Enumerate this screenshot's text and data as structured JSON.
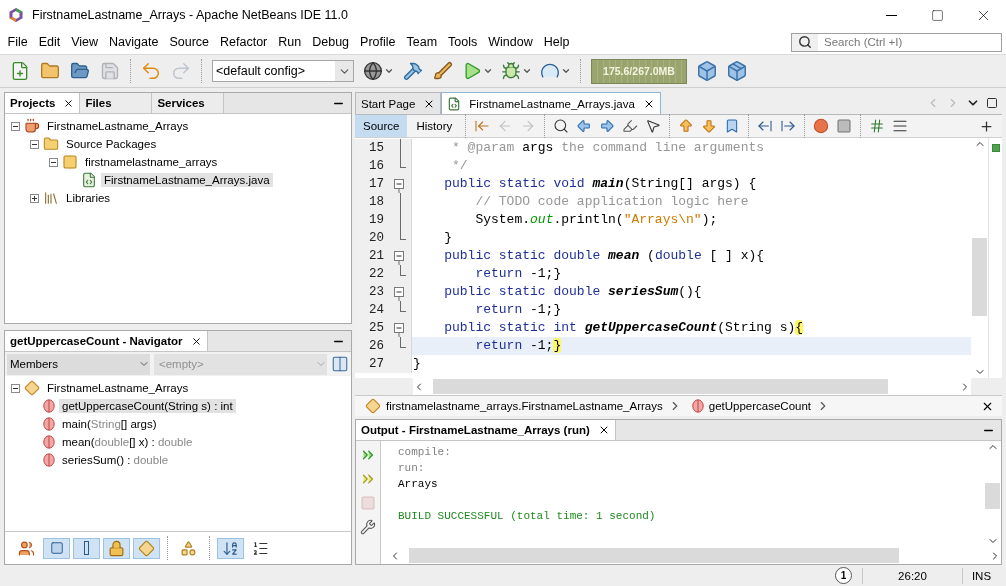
{
  "window": {
    "title": "FirstnameLastname_Arrays - Apache NetBeans IDE 11.0"
  },
  "menu": [
    "File",
    "Edit",
    "View",
    "Navigate",
    "Source",
    "Refactor",
    "Run",
    "Debug",
    "Profile",
    "Team",
    "Tools",
    "Window",
    "Help"
  ],
  "search": {
    "placeholder": "Search (Ctrl +I)"
  },
  "toolbar": {
    "groups": [
      [
        {
          "kind": "new-file",
          "disabled": false
        },
        {
          "kind": "new-project",
          "disabled": false
        },
        {
          "kind": "open-project",
          "disabled": false
        },
        {
          "kind": "save-all",
          "disabled": true
        }
      ],
      [
        {
          "kind": "undo",
          "disabled": false
        },
        {
          "kind": "redo",
          "disabled": true
        }
      ],
      [
        {
          "kind": "globe",
          "disabled": false,
          "has_menu": true
        },
        {
          "kind": "build",
          "disabled": false
        },
        {
          "kind": "clean-build",
          "disabled": false
        },
        {
          "kind": "run",
          "disabled": false,
          "has_menu": true
        },
        {
          "kind": "debug",
          "disabled": false,
          "has_menu": true
        },
        {
          "kind": "profile",
          "disabled": false,
          "has_menu": true
        }
      ],
      [
        {
          "kind": "gc",
          "disabled": false
        },
        {
          "kind": "pause",
          "disabled": false
        }
      ]
    ],
    "config": "<default config>",
    "memory": "175.6/267.0MB"
  },
  "projects_panel": {
    "tabs": [
      {
        "label": "Projects",
        "selected": true
      },
      {
        "label": "Files",
        "selected": false
      },
      {
        "label": "Services",
        "selected": false
      }
    ],
    "tree": [
      {
        "label": "FirstnameLastname_Arrays",
        "kind": "project",
        "expanded": true,
        "selected": false,
        "children": [
          {
            "label": "Source Packages",
            "kind": "source-folder",
            "expanded": true,
            "selected": false,
            "children": [
              {
                "label": "firstnamelastname_arrays",
                "kind": "package",
                "expanded": true,
                "selected": false,
                "children": [
                  {
                    "label": "FirstnameLastname_Arrays.java",
                    "kind": "java-file",
                    "selected": true
                  }
                ]
              }
            ]
          },
          {
            "label": "Libraries",
            "kind": "library-folder",
            "expanded": false,
            "selected": false
          }
        ]
      }
    ]
  },
  "navigator": {
    "title": "getUppercaseCount - Navigator",
    "filter": "Members",
    "scope": {
      "placeholder": "<empty>"
    },
    "tree": [
      {
        "label": "FirstnameLastname_Arrays",
        "kind": "class",
        "expanded": true,
        "selected": false,
        "children": [
          {
            "kind": "method",
            "selected": true,
            "parts": [
              {
                "text": "getUppercaseCount(String s) : int",
                "muted": false
              }
            ]
          },
          {
            "kind": "method",
            "selected": false,
            "parts": [
              {
                "text": "main(",
                "muted": false
              },
              {
                "text": "String",
                "muted": true
              },
              {
                "text": "[] args)",
                "muted": false
              }
            ]
          },
          {
            "kind": "method",
            "selected": false,
            "parts": [
              {
                "text": "mean(",
                "muted": false
              },
              {
                "text": "double",
                "muted": true
              },
              {
                "text": "[] x) : ",
                "muted": false
              },
              {
                "text": "double",
                "muted": true
              }
            ]
          },
          {
            "kind": "method",
            "selected": false,
            "parts": [
              {
                "text": "seriesSum() : ",
                "muted": false
              },
              {
                "text": "double",
                "muted": true
              }
            ]
          }
        ]
      }
    ],
    "filters": [
      {
        "kind": "inherited",
        "selected": false
      },
      {
        "kind": "fields",
        "selected": true
      },
      {
        "kind": "static",
        "selected": true
      },
      {
        "kind": "non-public",
        "selected": true
      },
      {
        "kind": "local-classes",
        "selected": true
      },
      {
        "kind": "class-members",
        "selected": false
      },
      {
        "kind": "sort-name",
        "selected": true
      },
      {
        "kind": "sort-source",
        "selected": false
      }
    ]
  },
  "editor": {
    "tabs": [
      {
        "label": "Start Page",
        "selected": false
      },
      {
        "label": "FirstnameLastname_Arrays.java",
        "selected": true
      }
    ],
    "views": [
      {
        "label": "Source",
        "selected": true
      },
      {
        "label": "History",
        "selected": false
      }
    ],
    "tools": [
      {
        "kind": "last-edit",
        "disabled": false
      },
      {
        "kind": "back",
        "disabled": true
      },
      {
        "kind": "forward",
        "disabled": true
      },
      {
        "kind": "find",
        "disabled": false
      },
      {
        "kind": "find-previous",
        "disabled": false
      },
      {
        "kind": "find-next",
        "disabled": false
      },
      {
        "kind": "highlight",
        "disabled": false
      },
      {
        "kind": "select",
        "disabled": false
      },
      {
        "kind": "previous-bookmark",
        "disabled": false
      },
      {
        "kind": "next-bookmark",
        "disabled": false
      },
      {
        "kind": "toggle-bookmark",
        "disabled": false
      },
      {
        "kind": "shift-left",
        "disabled": false
      },
      {
        "kind": "shift-right",
        "disabled": false
      },
      {
        "kind": "record",
        "disabled": false
      },
      {
        "kind": "stop",
        "disabled": false
      },
      {
        "kind": "comment",
        "disabled": false
      },
      {
        "kind": "uncomment",
        "disabled": false
      }
    ],
    "lines": [
      {
        "number": "15",
        "kind": "line",
        "current": false,
        "tokens": [
          {
            "text": "     * @param ",
            "kind": "comment"
          },
          {
            "text": "args",
            "kind": "plain"
          },
          {
            "text": " the command line arguments",
            "kind": "comment"
          }
        ]
      },
      {
        "number": "16",
        "kind": "end",
        "current": false,
        "tokens": [
          {
            "text": "     */",
            "kind": "comment"
          }
        ]
      },
      {
        "number": "17",
        "kind": "open",
        "current": false,
        "tokens": [
          {
            "text": "    public static void ",
            "kind": "keyword"
          },
          {
            "text": "main",
            "kind": "method"
          },
          {
            "text": "(String[] args) {",
            "kind": "plain"
          }
        ]
      },
      {
        "number": "18",
        "kind": "line",
        "current": false,
        "tokens": [
          {
            "text": "        // TODO code application logic here",
            "kind": "comment"
          }
        ]
      },
      {
        "number": "19",
        "kind": "line",
        "current": false,
        "tokens": [
          {
            "text": "        System.",
            "kind": "plain"
          },
          {
            "text": "out",
            "kind": "field"
          },
          {
            "text": ".println(",
            "kind": "plain"
          },
          {
            "text": "\"Arrays\\n\"",
            "kind": "string"
          },
          {
            "text": ");",
            "kind": "plain"
          }
        ]
      },
      {
        "number": "20",
        "kind": "end",
        "current": false,
        "tokens": [
          {
            "text": "    }",
            "kind": "plain"
          }
        ]
      },
      {
        "number": "21",
        "kind": "open",
        "current": false,
        "tokens": [
          {
            "text": "    public static double ",
            "kind": "keyword"
          },
          {
            "text": "mean",
            "kind": "method"
          },
          {
            "text": " (",
            "kind": "plain"
          },
          {
            "text": "double",
            "kind": "keyword"
          },
          {
            "text": " [ ] x){",
            "kind": "plain"
          }
        ]
      },
      {
        "number": "22",
        "kind": "end",
        "current": false,
        "tokens": [
          {
            "text": "        return",
            "kind": "keyword"
          },
          {
            "text": " -1;}",
            "kind": "plain"
          }
        ]
      },
      {
        "number": "23",
        "kind": "open",
        "current": false,
        "tokens": [
          {
            "text": "    public static double ",
            "kind": "keyword"
          },
          {
            "text": "seriesSum",
            "kind": "method"
          },
          {
            "text": "(){",
            "kind": "plain"
          }
        ]
      },
      {
        "number": "24",
        "kind": "end",
        "current": false,
        "tokens": [
          {
            "text": "        return",
            "kind": "keyword"
          },
          {
            "text": " -1;}",
            "kind": "plain"
          }
        ]
      },
      {
        "number": "25",
        "kind": "open",
        "current": false,
        "tokens": [
          {
            "text": "    public static int ",
            "kind": "keyword"
          },
          {
            "text": "getUppercaseCount",
            "kind": "method"
          },
          {
            "text": "(String s)",
            "kind": "plain"
          },
          {
            "text": "{",
            "kind": "match"
          }
        ]
      },
      {
        "number": "26",
        "kind": "end",
        "current": true,
        "tokens": [
          {
            "text": "        return",
            "kind": "keyword"
          },
          {
            "text": " -1;",
            "kind": "plain"
          },
          {
            "text": "}",
            "kind": "match"
          }
        ]
      },
      {
        "number": "27",
        "kind": "none",
        "current": false,
        "tokens": [
          {
            "text": "}",
            "kind": "plain"
          }
        ]
      }
    ],
    "breadcrumbs": [
      {
        "label": "firstnamelastname_arrays.FirstnameLastname_Arrays",
        "kind": "class"
      },
      {
        "label": "getUppercaseCount",
        "kind": "method"
      }
    ]
  },
  "output": {
    "title": "Output - FirstnameLastname_Arrays (run)",
    "actions": [
      {
        "kind": "rerun",
        "disabled": false
      },
      {
        "kind": "rerun-with-options",
        "disabled": false
      },
      {
        "kind": "stop",
        "disabled": true
      },
      {
        "kind": "settings",
        "disabled": false
      }
    ],
    "lines": [
      {
        "text": "compile:",
        "kind": "info"
      },
      {
        "text": "run:",
        "kind": "info"
      },
      {
        "text": "Arrays",
        "kind": "plain"
      },
      {
        "text": "BUILD SUCCESSFUL (total time: 1 second)",
        "kind": "success"
      }
    ]
  },
  "status_bar": {
    "notifications": "1",
    "position": "26:20",
    "mode": "INS"
  }
}
